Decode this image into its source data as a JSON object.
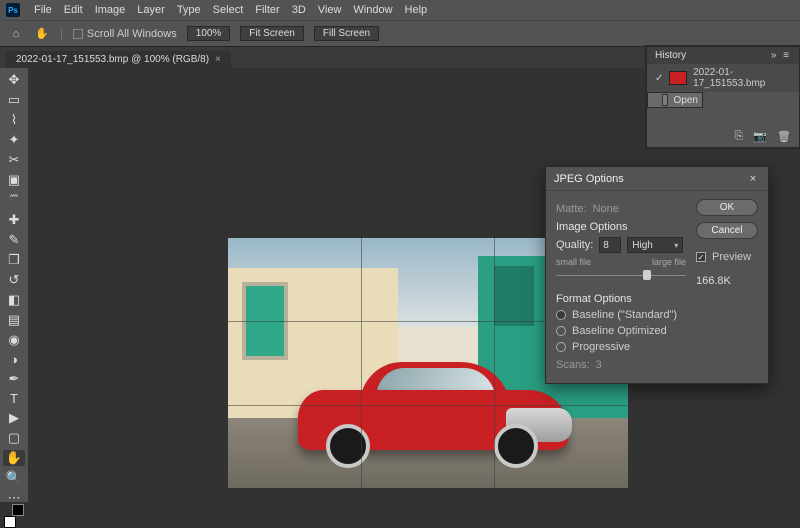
{
  "menu": {
    "items": [
      "File",
      "Edit",
      "Image",
      "Layer",
      "Type",
      "Select",
      "Filter",
      "3D",
      "View",
      "Window",
      "Help"
    ]
  },
  "optbar": {
    "scroll_all_label": "Scroll All Windows",
    "zoom": "100%",
    "fit_screen": "Fit Screen",
    "fill_screen": "Fill Screen"
  },
  "doc": {
    "tab_title": "2022-01-17_151553.bmp @ 100% (RGB/8)"
  },
  "history": {
    "title": "History",
    "file": "2022-01-17_151553.bmp",
    "step": "Open"
  },
  "dialog": {
    "title": "JPEG Options",
    "ok": "OK",
    "cancel": "Cancel",
    "preview_label": "Preview",
    "preview_checked": true,
    "filesize": "166.8K",
    "matte_label": "Matte:",
    "matte_value": "None",
    "image_options": "Image Options",
    "quality_label": "Quality:",
    "quality_value": "8",
    "quality_preset": "High",
    "small_file": "small file",
    "large_file": "large file",
    "slider_pct": 67,
    "format_options": "Format Options",
    "fmt_baseline": "Baseline (\"Standard\")",
    "fmt_optimized": "Baseline Optimized",
    "fmt_progressive": "Progressive",
    "fmt_selected": "baseline",
    "scans_label": "Scans:",
    "scans_value": "3"
  }
}
